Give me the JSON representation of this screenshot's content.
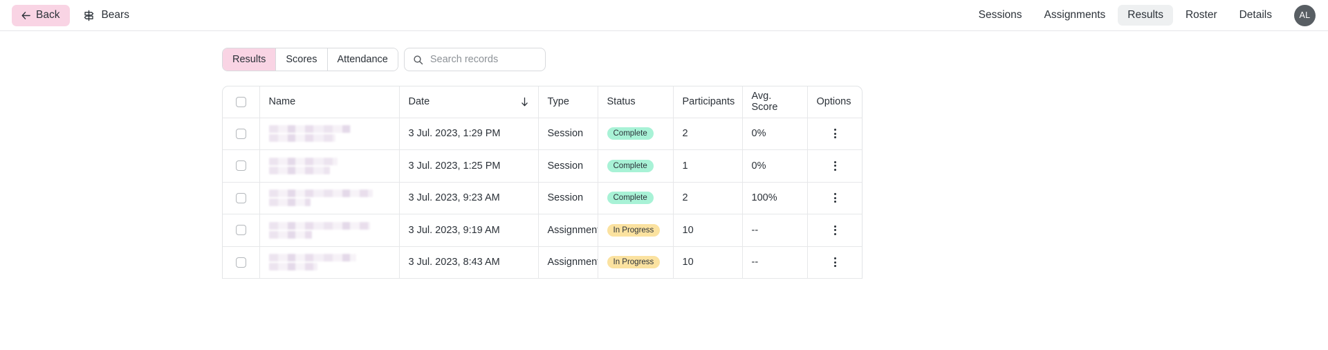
{
  "topbar": {
    "back_label": "Back",
    "breadcrumb": "Bears",
    "nav_items": [
      {
        "label": "Sessions",
        "active": false
      },
      {
        "label": "Assignments",
        "active": false
      },
      {
        "label": "Results",
        "active": true
      },
      {
        "label": "Roster",
        "active": false
      },
      {
        "label": "Details",
        "active": false
      }
    ],
    "avatar_initials": "AL"
  },
  "controls": {
    "segments": [
      {
        "label": "Results",
        "active": true
      },
      {
        "label": "Scores",
        "active": false
      },
      {
        "label": "Attendance",
        "active": false
      }
    ],
    "search_placeholder": "Search records",
    "search_value": ""
  },
  "table": {
    "columns": [
      "Name",
      "Date",
      "Type",
      "Status",
      "Participants",
      "Avg. Score",
      "Options"
    ],
    "sort_column": "Date",
    "sort_direction": "descending",
    "rows": [
      {
        "name": "",
        "name_redacted": true,
        "date": "3 Jul. 2023, 1:29 PM",
        "type": "Session",
        "status": "Complete",
        "status_kind": "complete",
        "participants": "2",
        "avg_score": "0%"
      },
      {
        "name": "",
        "name_redacted": true,
        "date": "3 Jul. 2023, 1:25 PM",
        "type": "Session",
        "status": "Complete",
        "status_kind": "complete",
        "participants": "1",
        "avg_score": "0%"
      },
      {
        "name": "",
        "name_redacted": true,
        "date": "3 Jul. 2023, 9:23 AM",
        "type": "Session",
        "status": "Complete",
        "status_kind": "complete",
        "participants": "2",
        "avg_score": "100%"
      },
      {
        "name": "",
        "name_redacted": true,
        "date": "3 Jul. 2023, 9:19 AM",
        "type": "Assignment",
        "status": "In Progress",
        "status_kind": "progress",
        "participants": "10",
        "avg_score": "--"
      },
      {
        "name": "",
        "name_redacted": true,
        "date": "3 Jul. 2023, 8:43 AM",
        "type": "Assignment",
        "status": "In Progress",
        "status_kind": "progress",
        "participants": "10",
        "avg_score": "--"
      }
    ]
  },
  "colors": {
    "accent_pink": "#f9d4e4",
    "badge_complete": "#a8f2d6",
    "badge_progress": "#fbe2a0",
    "avatar_bg": "#585e63",
    "tab_active_bg": "#eef0f1"
  }
}
